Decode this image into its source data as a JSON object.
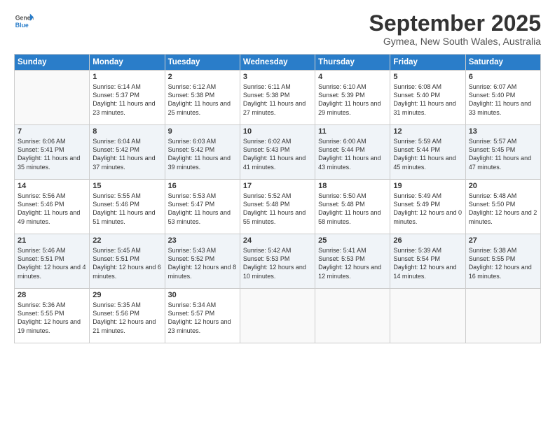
{
  "app": {
    "logo_line1": "General",
    "logo_line2": "Blue"
  },
  "header": {
    "month": "September 2025",
    "location": "Gymea, New South Wales, Australia"
  },
  "weekdays": [
    "Sunday",
    "Monday",
    "Tuesday",
    "Wednesday",
    "Thursday",
    "Friday",
    "Saturday"
  ],
  "weeks": [
    [
      {
        "day": "",
        "sunrise": "",
        "sunset": "",
        "daylight": ""
      },
      {
        "day": "1",
        "sunrise": "6:14 AM",
        "sunset": "5:37 PM",
        "daylight": "11 hours and 23 minutes."
      },
      {
        "day": "2",
        "sunrise": "6:12 AM",
        "sunset": "5:38 PM",
        "daylight": "11 hours and 25 minutes."
      },
      {
        "day": "3",
        "sunrise": "6:11 AM",
        "sunset": "5:38 PM",
        "daylight": "11 hours and 27 minutes."
      },
      {
        "day": "4",
        "sunrise": "6:10 AM",
        "sunset": "5:39 PM",
        "daylight": "11 hours and 29 minutes."
      },
      {
        "day": "5",
        "sunrise": "6:08 AM",
        "sunset": "5:40 PM",
        "daylight": "11 hours and 31 minutes."
      },
      {
        "day": "6",
        "sunrise": "6:07 AM",
        "sunset": "5:40 PM",
        "daylight": "11 hours and 33 minutes."
      }
    ],
    [
      {
        "day": "7",
        "sunrise": "6:06 AM",
        "sunset": "5:41 PM",
        "daylight": "11 hours and 35 minutes."
      },
      {
        "day": "8",
        "sunrise": "6:04 AM",
        "sunset": "5:42 PM",
        "daylight": "11 hours and 37 minutes."
      },
      {
        "day": "9",
        "sunrise": "6:03 AM",
        "sunset": "5:42 PM",
        "daylight": "11 hours and 39 minutes."
      },
      {
        "day": "10",
        "sunrise": "6:02 AM",
        "sunset": "5:43 PM",
        "daylight": "11 hours and 41 minutes."
      },
      {
        "day": "11",
        "sunrise": "6:00 AM",
        "sunset": "5:44 PM",
        "daylight": "11 hours and 43 minutes."
      },
      {
        "day": "12",
        "sunrise": "5:59 AM",
        "sunset": "5:44 PM",
        "daylight": "11 hours and 45 minutes."
      },
      {
        "day": "13",
        "sunrise": "5:57 AM",
        "sunset": "5:45 PM",
        "daylight": "11 hours and 47 minutes."
      }
    ],
    [
      {
        "day": "14",
        "sunrise": "5:56 AM",
        "sunset": "5:46 PM",
        "daylight": "11 hours and 49 minutes."
      },
      {
        "day": "15",
        "sunrise": "5:55 AM",
        "sunset": "5:46 PM",
        "daylight": "11 hours and 51 minutes."
      },
      {
        "day": "16",
        "sunrise": "5:53 AM",
        "sunset": "5:47 PM",
        "daylight": "11 hours and 53 minutes."
      },
      {
        "day": "17",
        "sunrise": "5:52 AM",
        "sunset": "5:48 PM",
        "daylight": "11 hours and 55 minutes."
      },
      {
        "day": "18",
        "sunrise": "5:50 AM",
        "sunset": "5:48 PM",
        "daylight": "11 hours and 58 minutes."
      },
      {
        "day": "19",
        "sunrise": "5:49 AM",
        "sunset": "5:49 PM",
        "daylight": "12 hours and 0 minutes."
      },
      {
        "day": "20",
        "sunrise": "5:48 AM",
        "sunset": "5:50 PM",
        "daylight": "12 hours and 2 minutes."
      }
    ],
    [
      {
        "day": "21",
        "sunrise": "5:46 AM",
        "sunset": "5:51 PM",
        "daylight": "12 hours and 4 minutes."
      },
      {
        "day": "22",
        "sunrise": "5:45 AM",
        "sunset": "5:51 PM",
        "daylight": "12 hours and 6 minutes."
      },
      {
        "day": "23",
        "sunrise": "5:43 AM",
        "sunset": "5:52 PM",
        "daylight": "12 hours and 8 minutes."
      },
      {
        "day": "24",
        "sunrise": "5:42 AM",
        "sunset": "5:53 PM",
        "daylight": "12 hours and 10 minutes."
      },
      {
        "day": "25",
        "sunrise": "5:41 AM",
        "sunset": "5:53 PM",
        "daylight": "12 hours and 12 minutes."
      },
      {
        "day": "26",
        "sunrise": "5:39 AM",
        "sunset": "5:54 PM",
        "daylight": "12 hours and 14 minutes."
      },
      {
        "day": "27",
        "sunrise": "5:38 AM",
        "sunset": "5:55 PM",
        "daylight": "12 hours and 16 minutes."
      }
    ],
    [
      {
        "day": "28",
        "sunrise": "5:36 AM",
        "sunset": "5:55 PM",
        "daylight": "12 hours and 19 minutes."
      },
      {
        "day": "29",
        "sunrise": "5:35 AM",
        "sunset": "5:56 PM",
        "daylight": "12 hours and 21 minutes."
      },
      {
        "day": "30",
        "sunrise": "5:34 AM",
        "sunset": "5:57 PM",
        "daylight": "12 hours and 23 minutes."
      },
      {
        "day": "",
        "sunrise": "",
        "sunset": "",
        "daylight": ""
      },
      {
        "day": "",
        "sunrise": "",
        "sunset": "",
        "daylight": ""
      },
      {
        "day": "",
        "sunrise": "",
        "sunset": "",
        "daylight": ""
      },
      {
        "day": "",
        "sunrise": "",
        "sunset": "",
        "daylight": ""
      }
    ]
  ]
}
